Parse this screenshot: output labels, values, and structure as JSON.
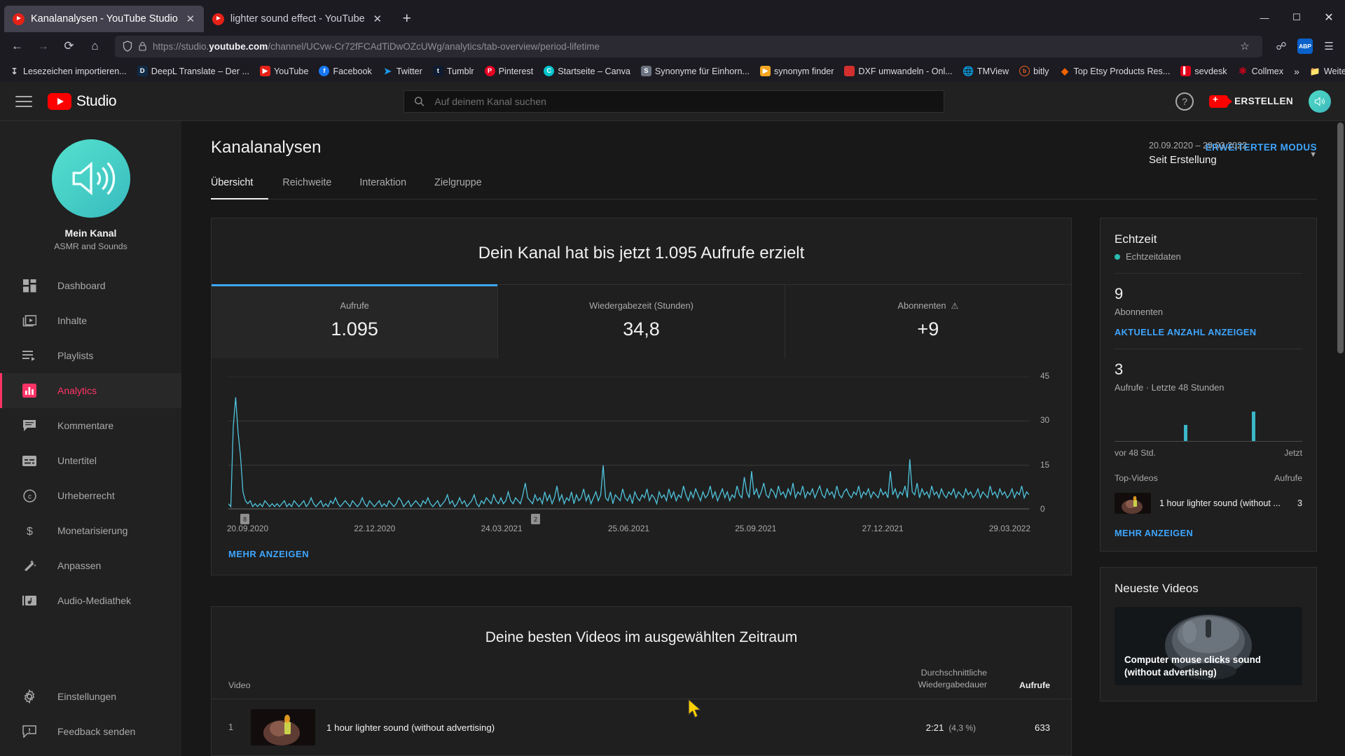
{
  "browser": {
    "tabs": [
      {
        "title": "Kanalanalysen - YouTube Studio",
        "favicon": "youtube-icon",
        "active": true
      },
      {
        "title": "lighter sound effect - YouTube",
        "favicon": "youtube-icon",
        "active": false
      }
    ],
    "new_tab_label": "+",
    "window_controls": {
      "minimize": "—",
      "maximize": "☐",
      "close": "✕"
    },
    "nav": {
      "back": "←",
      "forward": "→",
      "reload": "⟳",
      "home": "⌂"
    },
    "url": {
      "prefix": "https://studio.",
      "domain": "youtube.com",
      "rest": "/channel/UCvw-Cr72fFCAdTiDwOZcUWg/analytics/tab-overview/period-lifetime",
      "full": "https://studio.youtube.com/channel/UCvw-Cr72fFCAdTiDwOZcUWg/analytics/tab-overview/period-lifetime"
    },
    "toolbar_icons": [
      "shield-icon",
      "lock-icon",
      "bookmark-star-icon",
      "pocket-icon",
      "account-icon",
      "menu-icon"
    ],
    "account_badge": "ABP",
    "bookmarks": [
      {
        "label": "Lesezeichen importieren...",
        "icon": "import-icon",
        "color": "#8a8a93"
      },
      {
        "label": "DeepL Translate – Der ...",
        "icon": "deepl-icon",
        "color": "#0f2b46"
      },
      {
        "label": "YouTube",
        "icon": "youtube-icon",
        "color": "#e62117"
      },
      {
        "label": "Facebook",
        "icon": "facebook-icon",
        "color": "#1877f2"
      },
      {
        "label": "Twitter",
        "icon": "twitter-icon",
        "color": "#1d9bf0"
      },
      {
        "label": "Tumblr",
        "icon": "tumblr-icon",
        "color": "#0f1b30"
      },
      {
        "label": "Pinterest",
        "icon": "pinterest-icon",
        "color": "#e60023"
      },
      {
        "label": "Startseite – Canva",
        "icon": "canva-icon",
        "color": "#00c4cc"
      },
      {
        "label": "Synonyme für Einhorn...",
        "icon": "synonym-icon",
        "color": "#6b7280"
      },
      {
        "label": "synonym finder",
        "icon": "bookmark-icon",
        "color": "#f5a623"
      },
      {
        "label": "DXF umwandeln - Onl...",
        "icon": "dxf-icon",
        "color": "#d32f2f"
      },
      {
        "label": "TMView",
        "icon": "globe-icon",
        "color": "#9aa0a6"
      },
      {
        "label": "bitly",
        "icon": "bitly-icon",
        "color": "#ee6123"
      },
      {
        "label": "Top Etsy Products Res...",
        "icon": "etsy-icon",
        "color": "#f56400"
      },
      {
        "label": "sevdesk",
        "icon": "sevdesk-icon",
        "color": "#e2001a"
      },
      {
        "label": "Collmex",
        "icon": "collmex-icon",
        "color": "#e2001a"
      }
    ],
    "overflow_label": "»",
    "other_bookmarks": "Weitere Lesezeichen"
  },
  "studio": {
    "logo_text": "Studio",
    "search": {
      "placeholder": "Auf deinem Kanal suchen",
      "value": "",
      "icon": "search-icon"
    },
    "help_icon": "help-icon",
    "create_button": "ERSTELLEN",
    "avatar": "channel-avatar"
  },
  "sidebar": {
    "channel": {
      "name": "Mein Kanal",
      "subtitle": "ASMR and Sounds",
      "avatar": "speaker-avatar"
    },
    "items": [
      {
        "label": "Dashboard",
        "icon": "dashboard-icon",
        "active": false
      },
      {
        "label": "Inhalte",
        "icon": "content-icon",
        "active": false
      },
      {
        "label": "Playlists",
        "icon": "playlist-icon",
        "active": false
      },
      {
        "label": "Analytics",
        "icon": "analytics-icon",
        "active": true
      },
      {
        "label": "Kommentare",
        "icon": "comment-icon",
        "active": false
      },
      {
        "label": "Untertitel",
        "icon": "subtitles-icon",
        "active": false
      },
      {
        "label": "Urheberrecht",
        "icon": "copyright-icon",
        "active": false
      },
      {
        "label": "Monetarisierung",
        "icon": "dollar-icon",
        "active": false
      },
      {
        "label": "Anpassen",
        "icon": "wand-icon",
        "active": false
      },
      {
        "label": "Audio-Mediathek",
        "icon": "audio-library-icon",
        "active": false
      }
    ],
    "bottom_items": [
      {
        "label": "Einstellungen",
        "icon": "gear-icon"
      },
      {
        "label": "Feedback senden",
        "icon": "feedback-icon"
      }
    ]
  },
  "page": {
    "title": "Kanalanalysen",
    "advanced_mode": "ERWEITERTER MODUS",
    "tabs": [
      {
        "label": "Übersicht",
        "active": true
      },
      {
        "label": "Reichweite",
        "active": false
      },
      {
        "label": "Interaktion",
        "active": false
      },
      {
        "label": "Zielgruppe",
        "active": false
      }
    ],
    "date_range": {
      "dates": "20.09.2020 – 29.03.2022",
      "label": "Seit Erstellung",
      "chevron": "▼"
    }
  },
  "overview": {
    "headline": "Dein Kanal hat bis jetzt 1.095 Aufrufe erzielt",
    "metrics": [
      {
        "label": "Aufrufe",
        "value": "1.095",
        "selected": true,
        "warning": false
      },
      {
        "label": "Wiedergabezeit (Stunden)",
        "value": "34,8",
        "selected": false,
        "warning": false
      },
      {
        "label": "Abonnenten",
        "value": "+9",
        "selected": false,
        "warning": true,
        "warning_icon": "warning-icon"
      }
    ],
    "more_link": "MEHR ANZEIGEN"
  },
  "chart_data": {
    "type": "line",
    "title": "Aufrufe",
    "xlabel": "",
    "ylabel": "Aufrufe",
    "ylim": [
      0,
      45
    ],
    "yticks": [
      0,
      15,
      30,
      45
    ],
    "xtick_labels": [
      "20.09.2020",
      "22.12.2020",
      "24.03.2021",
      "25.06.2021",
      "25.09.2021",
      "27.12.2021",
      "29.03.2022"
    ],
    "grid": true,
    "line_color": "#4fc3dc",
    "annotations": [
      {
        "label": "8",
        "x_position_pct": 1.5
      },
      {
        "label": "2",
        "x_position_pct": 37.8
      }
    ],
    "values": [
      2,
      1,
      28,
      38,
      26,
      18,
      6,
      3,
      2,
      3,
      1,
      2,
      1,
      2,
      1,
      3,
      2,
      1,
      2,
      1,
      2,
      1,
      2,
      3,
      1,
      2,
      1,
      3,
      2,
      1,
      2,
      3,
      1,
      2,
      4,
      2,
      1,
      2,
      3,
      1,
      2,
      1,
      3,
      2,
      4,
      2,
      1,
      2,
      3,
      2,
      1,
      3,
      2,
      1,
      2,
      4,
      2,
      1,
      3,
      2,
      1,
      2,
      3,
      1,
      2,
      1,
      3,
      2,
      1,
      2,
      4,
      3,
      1,
      2,
      3,
      1,
      2,
      3,
      2,
      1,
      3,
      2,
      4,
      2,
      1,
      2,
      3,
      1,
      2,
      3,
      5,
      2,
      3,
      1,
      2,
      4,
      2,
      3,
      1,
      2,
      3,
      5,
      2,
      1,
      3,
      2,
      4,
      3,
      2,
      5,
      3,
      2,
      4,
      2,
      3,
      6,
      3,
      2,
      4,
      3,
      2,
      5,
      9,
      4,
      3,
      2,
      5,
      3,
      4,
      2,
      6,
      3,
      5,
      2,
      4,
      8,
      3,
      5,
      2,
      4,
      3,
      6,
      2,
      5,
      3,
      4,
      7,
      3,
      5,
      2,
      4,
      6,
      3,
      5,
      15,
      4,
      3,
      6,
      2,
      5,
      4,
      3,
      7,
      4,
      3,
      5,
      2,
      6,
      4,
      3,
      5,
      4,
      7,
      3,
      5,
      4,
      2,
      6,
      4,
      5,
      3,
      7,
      4,
      6,
      3,
      5,
      4,
      8,
      5,
      3,
      6,
      4,
      7,
      5,
      3,
      6,
      4,
      5,
      8,
      4,
      6,
      3,
      5,
      7,
      4,
      6,
      3,
      5,
      4,
      8,
      5,
      4,
      11,
      6,
      4,
      13,
      5,
      7,
      4,
      6,
      9,
      5,
      4,
      7,
      6,
      4,
      8,
      5,
      6,
      4,
      7,
      5,
      9,
      4,
      6,
      5,
      8,
      4,
      6,
      5,
      7,
      4,
      6,
      8,
      5,
      4,
      7,
      5,
      6,
      4,
      8,
      5,
      4,
      6,
      7,
      5,
      4,
      6,
      5,
      8,
      4,
      6,
      5,
      7,
      4,
      6,
      5,
      4,
      7,
      5,
      6,
      4,
      13,
      5,
      7,
      4,
      6,
      5,
      8,
      4,
      17,
      6,
      5,
      9,
      4,
      7,
      5,
      6,
      4,
      8,
      5,
      6,
      4,
      7,
      5,
      4,
      6,
      5,
      7,
      4,
      6,
      5,
      4,
      7,
      5,
      6,
      4,
      5,
      7,
      4,
      6,
      5,
      4,
      8,
      5,
      6,
      4,
      7,
      5,
      6,
      4,
      5,
      7,
      4,
      6,
      5,
      8,
      4,
      6,
      5
    ]
  },
  "top_videos": {
    "title": "Deine besten Videos im ausgewählten Zeitraum",
    "columns": {
      "video": "Video",
      "duration": "Durchschnittliche Wiedergabedauer",
      "views": "Aufrufe"
    },
    "rows": [
      {
        "rank": "1",
        "title": "1 hour lighter sound (without advertising)",
        "duration": "2:21",
        "percent": "(4,3 %)",
        "views": "633"
      }
    ]
  },
  "realtime": {
    "title": "Echtzeit",
    "live_label": "Echtzeitdaten",
    "subscribers": {
      "value": "9",
      "caption": "Abonnenten",
      "link": "AKTUELLE ANZAHL ANZEIGEN"
    },
    "views": {
      "value": "3",
      "caption": "Aufrufe · Letzte 48 Stunden"
    },
    "spark_bars": [
      {
        "position_pct": 37,
        "height_pct": 55
      },
      {
        "position_pct": 73,
        "height_pct": 100
      }
    ],
    "axis": {
      "left": "vor 48 Std.",
      "right": "Jetzt"
    },
    "top_videos_header": {
      "left": "Top-Videos",
      "right": "Aufrufe"
    },
    "top_video": {
      "title": "1 hour lighter sound (without ...",
      "views": "3"
    },
    "more_link": "MEHR ANZEIGEN"
  },
  "latest_videos": {
    "title": "Neueste Videos",
    "video_caption": "Computer mouse clicks sound (without advertising)"
  },
  "colors": {
    "accent_blue": "#3ea6ff",
    "chart_cyan": "#4fc3dc",
    "youtube_red": "#ff0000",
    "active_nav": "#ff3366",
    "panel_bg": "#1f1f1f",
    "page_bg": "#181818"
  }
}
